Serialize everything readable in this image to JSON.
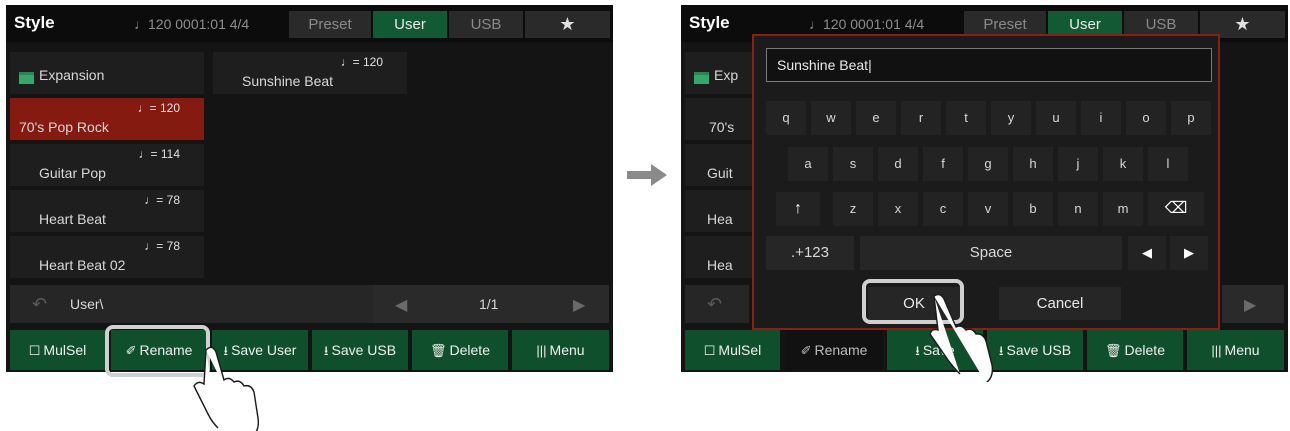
{
  "left": {
    "title": "Style",
    "tempo_bar": "♩120  0001:01  4/4",
    "tabs": [
      "Preset",
      "User",
      "USB",
      "★"
    ],
    "folder_label": "Expansion",
    "styles": [
      {
        "tempo": "♩= 120",
        "name": "70's Pop Rock"
      },
      {
        "tempo": "♩= 114",
        "name": "Guitar Pop"
      },
      {
        "tempo": "♩= 78",
        "name": "Heart Beat"
      },
      {
        "tempo": "♩= 78",
        "name": "Heart Beat 02"
      }
    ],
    "user_style": {
      "tempo": "♩= 120",
      "name": "Sunshine Beat"
    },
    "path_label": "User\\",
    "page_label": "1/1",
    "buttons": {
      "mulsel": "MulSel",
      "rename": "Rename",
      "save_user": "Save User",
      "save_usb": "Save USB",
      "delete": "Delete",
      "menu": "Menu"
    },
    "icons": {
      "mulsel": "multi-select-icon",
      "rename": "rename-icon",
      "save_user": "save-user-icon",
      "save_usb": "save-usb-icon",
      "delete": "trash-icon",
      "menu": "menu-bars-icon"
    }
  },
  "right": {
    "title": "Style",
    "tempo_bar": "♩120  0001:01  4/4",
    "tabs": [
      "Preset",
      "User",
      "USB",
      "★"
    ],
    "bg_labels": [
      "Exp",
      "70's",
      "Guit",
      "Hea",
      "Hea"
    ],
    "input_value": "Sunshine Beat|",
    "keys_row1": [
      "q",
      "w",
      "e",
      "r",
      "t",
      "y",
      "u",
      "i",
      "o",
      "p"
    ],
    "keys_row2": [
      "a",
      "s",
      "d",
      "f",
      "g",
      "h",
      "j",
      "k",
      "l"
    ],
    "keys_row3": [
      "↑",
      "z",
      "x",
      "c",
      "v",
      "b",
      "n",
      "m",
      "⌫"
    ],
    "numbers_key": ".+123",
    "space_key": "Space",
    "arrow_left": "◀",
    "arrow_right": "▶",
    "ok_button": "OK",
    "cancel_button": "Cancel",
    "buttons": {
      "mulsel": "MulSel",
      "rename": "Rename",
      "save_user": "Save",
      "save_usb": "Save USB",
      "delete": "Delete",
      "menu": "Menu"
    }
  },
  "colors": {
    "accent_green": "#125a33",
    "button_green": "#0f4f2b",
    "selected_red": "#851a10",
    "dialog_border": "#8a1f14"
  }
}
